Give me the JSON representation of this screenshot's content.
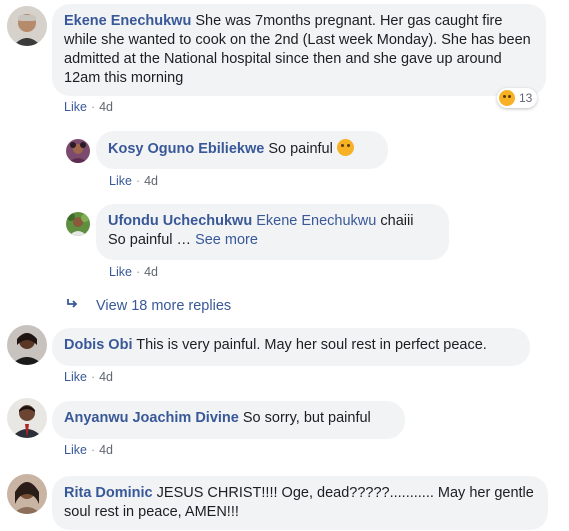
{
  "comments": [
    {
      "name": "Ekene Enechukwu",
      "text": "She was 7months pregnant. Her gas caught fire while she wanted to cook on the 2nd (Last week Monday). She has been admitted at the National hospital since then and she gave up around 12am this morning",
      "like": "Like",
      "time": "4d",
      "reaction_count": "13",
      "reaction_icon": "sad-face-icon"
    }
  ],
  "replies": [
    {
      "name": "Kosy Oguno Ebiliekwe",
      "text": "So painful",
      "like": "Like",
      "time": "4d"
    },
    {
      "name": "Ufondu Uchechukwu",
      "mention": "Ekene Enechukwu",
      "text1": "chaiii",
      "text2": "So painful …",
      "see_more": "See more",
      "like": "Like",
      "time": "4d"
    }
  ],
  "view_more": {
    "label": "View 18 more replies"
  },
  "more_comments": [
    {
      "name": "Dobis Obi",
      "text": "This is very painful. May her soul rest in perfect peace.",
      "like": "Like",
      "time": "4d"
    },
    {
      "name": "Anyanwu Joachim Divine",
      "text": "So sorry, but painful",
      "like": "Like",
      "time": "4d"
    },
    {
      "name": "Rita Dominic",
      "text": "JESUS CHRIST!!!! Oge, dead?????........... May her gentle soul rest in peace, AMEN!!!"
    }
  ],
  "colors": {
    "link": "#385898",
    "bubble": "#f2f3f5",
    "meta": "#616770"
  }
}
